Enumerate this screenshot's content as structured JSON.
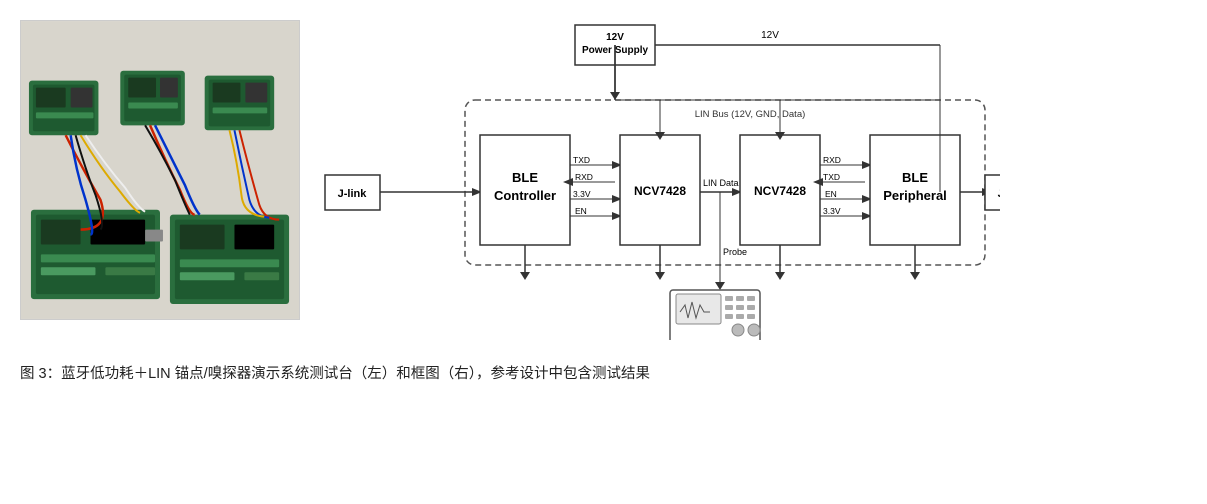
{
  "photo": {
    "alt": "PCB boards with wires photo"
  },
  "diagram": {
    "power_supply_label": "12V\nPower Supply",
    "voltage_label": "12V",
    "lin_bus_label": "LIN Bus (12V, GND, Data)",
    "ble_controller_label": "BLE\nController",
    "ncv7428_left_label": "NCV7428",
    "ncv7428_right_label": "NCV7428",
    "ble_peripheral_label": "BLE\nPeripheral",
    "jlink_left_label": "J-link",
    "jlink_right_label": "J-link",
    "probe_label": "Probe",
    "lin_data_label": "LIN Data",
    "txd_label": "TXD",
    "rxd_left_label": "RXD",
    "v33_left_label": "3.3V",
    "en_left_label": "EN",
    "rxd_right_label": "RXD",
    "txd_right_label": "TXD",
    "en_right_label": "EN",
    "v33_right_label": "3.3V",
    "oscilloscope_alt": "Oscilloscope"
  },
  "caption": {
    "text": "图 3：蓝牙低功耗＋LIN 锚点/嗅探器演示系统测试台（左）和框图（右），参考设计中包含测试结果"
  }
}
